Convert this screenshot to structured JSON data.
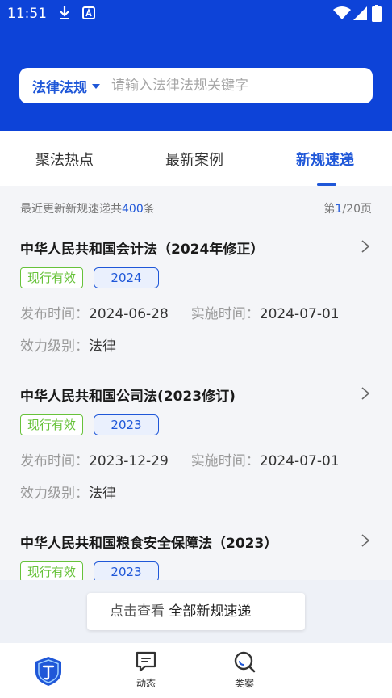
{
  "status_bar": {
    "time": "11:51"
  },
  "search": {
    "category": "法律法规",
    "placeholder": "请输入法律法规关键字"
  },
  "tabs": [
    {
      "label": "聚法热点"
    },
    {
      "label": "最新案例"
    },
    {
      "label": "新规速递"
    }
  ],
  "summary": {
    "prefix": "最近更新新规速递共",
    "count": "400",
    "suffix": "条"
  },
  "pager": {
    "prefix": "第",
    "current": "1",
    "suffix": "/20页"
  },
  "labels": {
    "publish": "发布时间：",
    "effective": "实施时间：",
    "level": "效力级别："
  },
  "items": [
    {
      "title": "中华人民共和国会计法（2024年修正）",
      "status": "现行有效",
      "year": "2024",
      "publish": "2024-06-28",
      "effective": "2024-07-01",
      "level": "法律"
    },
    {
      "title": "中华人民共和国公司法(2023修订)",
      "status": "现行有效",
      "year": "2023",
      "publish": "2023-12-29",
      "effective": "2024-07-01",
      "level": "法律"
    },
    {
      "title": "中华人民共和国粮食安全保障法（2023）",
      "status": "现行有效",
      "year": "2023"
    }
  ],
  "view_all": {
    "prefix": "点击查看",
    "strong": "全部新规速递"
  },
  "bottom_nav": [
    {
      "label": "动态",
      "icon": "message-icon"
    },
    {
      "label": "类案",
      "icon": "search-icon"
    }
  ],
  "colors": {
    "header": "#0d43d8",
    "accent": "#1f57d8",
    "status_green": "#67c23a"
  }
}
